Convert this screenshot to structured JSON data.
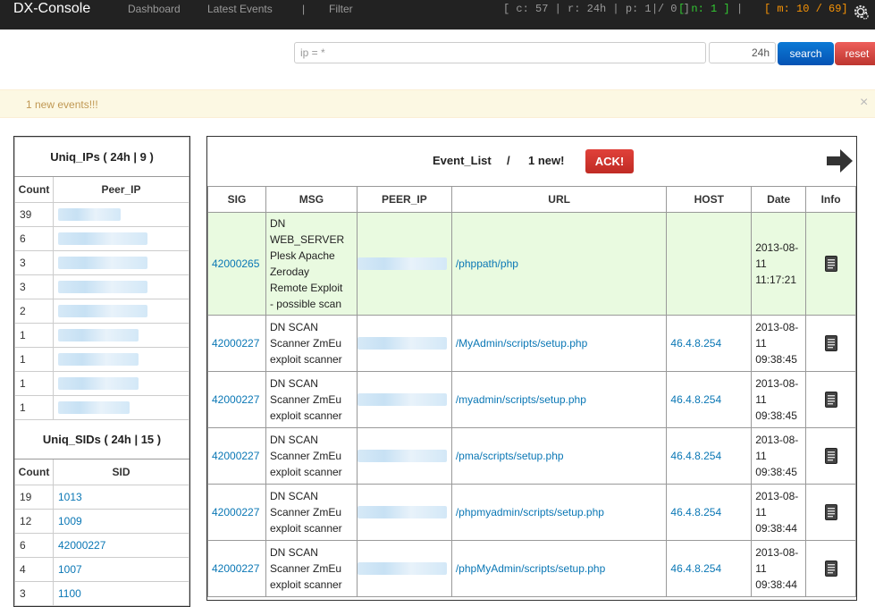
{
  "nav": {
    "brand": "DX-Console",
    "links": [
      "Dashboard",
      "Latest Events",
      "|",
      "Filter"
    ],
    "stats": {
      "counters": "[ c: 57 | r: 24h | p: 1 / 0 ]",
      "sep1": "|",
      "new": "[ n: 1 ]",
      "sep2": "|",
      "msgs": "[ m: 10 / 69]"
    },
    "colors": {
      "new": "#33cc33",
      "msgs": "#f89406"
    }
  },
  "search": {
    "ip_placeholder": "ip = *",
    "time_value": "24h",
    "search_label": "search",
    "reset_label": "reset"
  },
  "alert": {
    "text": "1 new events!!!",
    "close": "×"
  },
  "uniq_ips": {
    "title": "Uniq_IPs ( 24h | 9 )",
    "headers": [
      "Count",
      "Peer_IP"
    ],
    "counts": [
      "39",
      "6",
      "3",
      "3",
      "2",
      "1",
      "1",
      "1",
      "1"
    ]
  },
  "uniq_sids": {
    "title": "Uniq_SIDs ( 24h | 15 )",
    "headers": [
      "Count",
      "SID"
    ],
    "rows": [
      {
        "count": "19",
        "sid": "1013"
      },
      {
        "count": "12",
        "sid": "1009"
      },
      {
        "count": "6",
        "sid": "42000227"
      },
      {
        "count": "4",
        "sid": "1007"
      },
      {
        "count": "3",
        "sid": "1100"
      }
    ]
  },
  "events": {
    "title": "Event_List",
    "slash": "/",
    "new_count": "1 new!",
    "ack_label": "ACK!",
    "headers": [
      "SIG",
      "MSG",
      "PEER_IP",
      "URL",
      "HOST",
      "Date",
      "Info"
    ],
    "rows": [
      {
        "sig": "42000265",
        "msg": [
          "DN",
          "WEB_SERVER",
          "Plesk Apache",
          "Zeroday",
          "Remote Exploit",
          "- possible scan"
        ],
        "url": "/phppath/php",
        "host": "",
        "date": [
          "2013-08-",
          "11",
          "11:17:21"
        ]
      },
      {
        "sig": "42000227",
        "msg": [
          "DN SCAN",
          "Scanner ZmEu",
          "exploit scanner"
        ],
        "url": "/MyAdmin/scripts/setup.php",
        "host": "46.4.8.254",
        "date": [
          "2013-08-",
          "11",
          "09:38:45"
        ]
      },
      {
        "sig": "42000227",
        "msg": [
          "DN SCAN",
          "Scanner ZmEu",
          "exploit scanner"
        ],
        "url": "/myadmin/scripts/setup.php",
        "host": "46.4.8.254",
        "date": [
          "2013-08-",
          "11",
          "09:38:45"
        ]
      },
      {
        "sig": "42000227",
        "msg": [
          "DN SCAN",
          "Scanner ZmEu",
          "exploit scanner"
        ],
        "url": "/pma/scripts/setup.php",
        "host": "46.4.8.254",
        "date": [
          "2013-08-",
          "11",
          "09:38:45"
        ]
      },
      {
        "sig": "42000227",
        "msg": [
          "DN SCAN",
          "Scanner ZmEu",
          "exploit scanner"
        ],
        "url": "/phpmyadmin/scripts/setup.php",
        "host": "46.4.8.254",
        "date": [
          "2013-08-",
          "11",
          "09:38:44"
        ]
      },
      {
        "sig": "42000227",
        "msg": [
          "DN SCAN",
          "Scanner ZmEu",
          "exploit scanner"
        ],
        "url": "/phpMyAdmin/scripts/setup.php",
        "host": "46.4.8.254",
        "date": [
          "2013-08-",
          "11",
          "09:38:44"
        ]
      }
    ]
  },
  "icons": {
    "settings": "gear-icon",
    "next": "arrow-right-icon",
    "info": "document-icon"
  }
}
